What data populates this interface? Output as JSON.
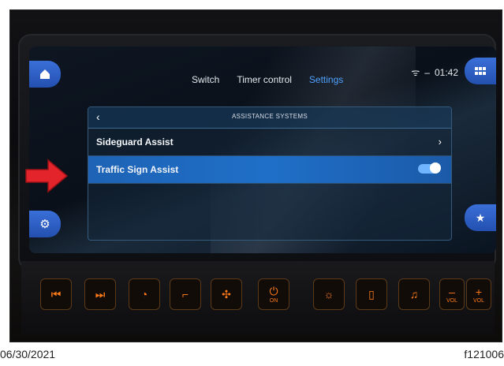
{
  "status": {
    "time": "01:42"
  },
  "tabs": [
    "Switch",
    "Timer control",
    "Settings"
  ],
  "panel": {
    "title": "ASSISTANCE SYSTEMS",
    "rows": [
      {
        "label": "Sideguard Assist",
        "control": "chevron-right"
      },
      {
        "label": "Traffic Sign Assist",
        "control": "toggle",
        "toggle_on": true
      }
    ]
  },
  "control_strip": {
    "power_label": "ON",
    "vol_minus_label": "VOL",
    "vol_plus_label": "VOL"
  },
  "footer": {
    "date": "06/30/2021",
    "code": "f121006"
  },
  "colors": {
    "accent": "#4fa0ff",
    "highlight_row": "#1f6fc8",
    "arrow": "#e3242b",
    "button_glow": "#ff7a18"
  }
}
